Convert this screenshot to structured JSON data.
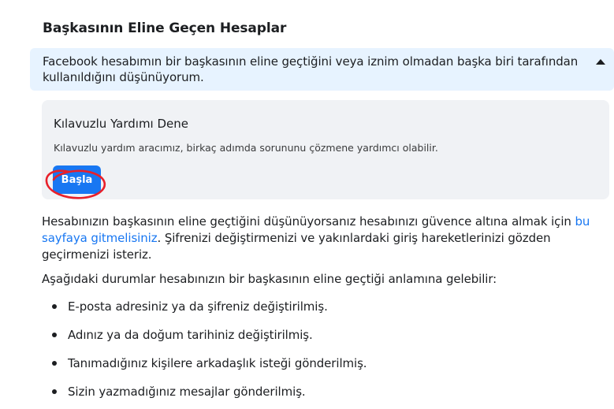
{
  "section": {
    "title": "Başkasının Eline Geçen Hesaplar"
  },
  "question": {
    "text": "Facebook hesabımın bir başkasının eline geçtiğini veya iznim olmadan başka biri tarafından kullanıldığını düşünüyorum.",
    "expanded_icon": "caret-up-icon"
  },
  "guided_help": {
    "title": "Kılavuzlu Yardımı Dene",
    "description": "Kılavuzlu yardım aracımız, birkaç adımda sorununu çözmene yardımcı olabilir.",
    "start_label": "Başla",
    "button_color": "#1877f2"
  },
  "annotation": {
    "color": "#e8202a",
    "shape": "hand-drawn circle"
  },
  "content": {
    "p1_before": "Hesabınızın başkasının eline geçtiğini düşünüyorsanız hesabınızı güvence altına almak için ",
    "p1_link": "bu sayfaya gitmelisiniz",
    "p1_after": ". Şifrenizi değiştirmenizi ve yakınlardaki giriş hareketlerinizi gözden geçirmenizi isteriz.",
    "p2": "Aşağıdaki durumlar hesabınızın bir başkasının eline geçtiği anlamına gelebilir:",
    "bullets": [
      "E-posta adresiniz ya da şifreniz değiştirilmiş.",
      "Adınız ya da doğum tarihiniz değiştirilmiş.",
      "Tanımadığınız kişilere arkadaşlık isteği gönderilmiş.",
      "Sizin yazmadığınız mesajlar gönderilmiş."
    ]
  }
}
